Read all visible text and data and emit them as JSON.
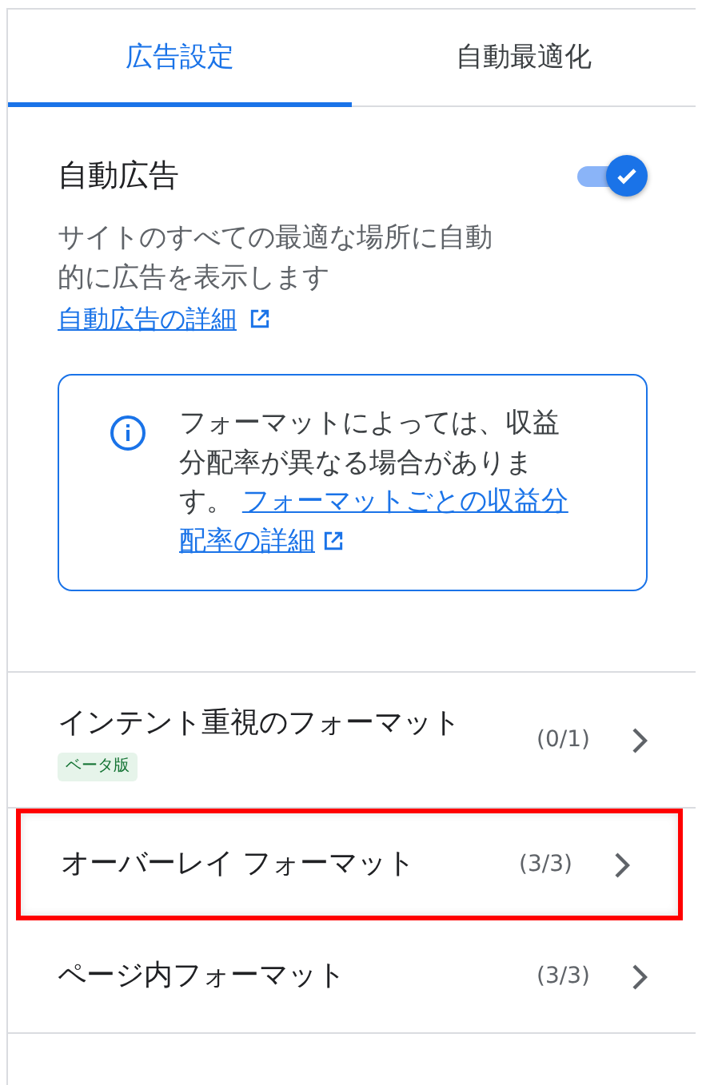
{
  "tabs": [
    {
      "label": "広告設定",
      "selected": true
    },
    {
      "label": "自動最適化",
      "selected": false
    }
  ],
  "auto_ads": {
    "title": "自動広告",
    "on": true,
    "description": "サイトのすべての最適な場所に自動的に広告を表示します",
    "link": "自動広告の詳細"
  },
  "info_box": {
    "text": "フォーマットによっては、収益分配率が異なる場合があります。",
    "link_lines": [
      "フォーマットごとの収益分",
      "配率の詳細"
    ]
  },
  "formats": [
    {
      "name": "インテント重視のフォーマット",
      "badge": "ベータ版",
      "count": "(0/1)",
      "highlighted": false
    },
    {
      "name": "オーバーレイ フォーマット",
      "count": "(3/3)",
      "highlighted": true
    },
    {
      "name": "ページ内フォーマット",
      "count": "(3/3)",
      "highlighted": false
    }
  ]
}
